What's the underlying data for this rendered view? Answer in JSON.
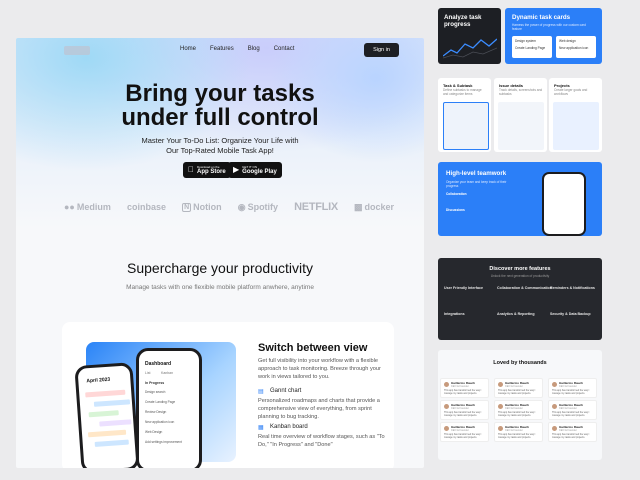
{
  "header": {
    "logo": "LOGO",
    "nav": [
      "Home",
      "Features",
      "Blog",
      "Contact"
    ],
    "signin_label": "Sign in"
  },
  "hero": {
    "title_line1": "Bring your tasks",
    "title_line2": "under full control",
    "subtitle_line1": "Master Your To-Do List: Organize Your Life with",
    "subtitle_line2": "Our Top-Rated Mobile Task App!",
    "app_store_small": "Download on the",
    "app_store_big": "App Store",
    "google_small": "GET IT ON",
    "google_big": "Google Play"
  },
  "brands": [
    "Medium",
    "coinbase",
    "Notion",
    "Spotify",
    "NETFLIX",
    "docker"
  ],
  "productivity": {
    "title": "Supercharge your productivity",
    "subtitle": "Manage tasks with one flexible mobile platform anwhere, anytime"
  },
  "feature": {
    "title": "Switch between view",
    "description": "Get full visibility into your workflow with a flexible approach to task monitoring. Breeze through your work in views tailored to you.",
    "item1_title": "Gannt chart",
    "item1_text": "Personalized roadmaps and charts that provide a comprehensive view of everything, from sprint planning to bug tracking.",
    "item2_title": "Kanban board",
    "item2_text": "Real time overview of workflow stages, such as \"To Do,\" \"In Progress\" and \"Done\"",
    "phone_back_header": "April 2023",
    "phone_front_header": "Dashboard",
    "phone_front_tabs": [
      "List",
      "Kanban"
    ],
    "phone_front_rows": [
      "In Progress",
      "Design search",
      "Create Landing Page",
      "Review Design",
      "New application icon",
      "Web Design",
      "Add settings improvement"
    ]
  },
  "right": {
    "analyze_title": "Analyze task progress",
    "dynamic_title": "Dynamic task cards",
    "dynamic_sub": "Harness the power of progress with our custom card feature",
    "card_labels": [
      "Design system",
      "Web design",
      "Create Landing Page",
      "New application icon"
    ],
    "small_cards": [
      {
        "title": "Task & Subtask",
        "text": "Define subtasks to manage and categorize items"
      },
      {
        "title": "Issue details",
        "text": "Track details, screenshots and subtasks"
      },
      {
        "title": "Projects",
        "text": "Create larger goals and workflows"
      }
    ],
    "teamwork_title": "High-level teamwork",
    "teamwork_sub": "Organize your team and keep track of their progress",
    "teamwork_items": [
      "Collaboration",
      "Discussions"
    ],
    "discover_title": "Discover more features",
    "discover_sub": "Unlock the next generation of productivity",
    "discover_features": [
      "User Friendly Interface",
      "Collaboration & Communication",
      "Reminders & Notifications",
      "Integrations",
      "Analytics & Reporting",
      "Security & Data Backup"
    ],
    "loved_title": "Loved by thousands",
    "reviewer_name": "Guillermo Rauch",
    "review_role": "CEO & Founder",
    "review_text": "This app has transformed the way I manage my tasks and projects."
  }
}
